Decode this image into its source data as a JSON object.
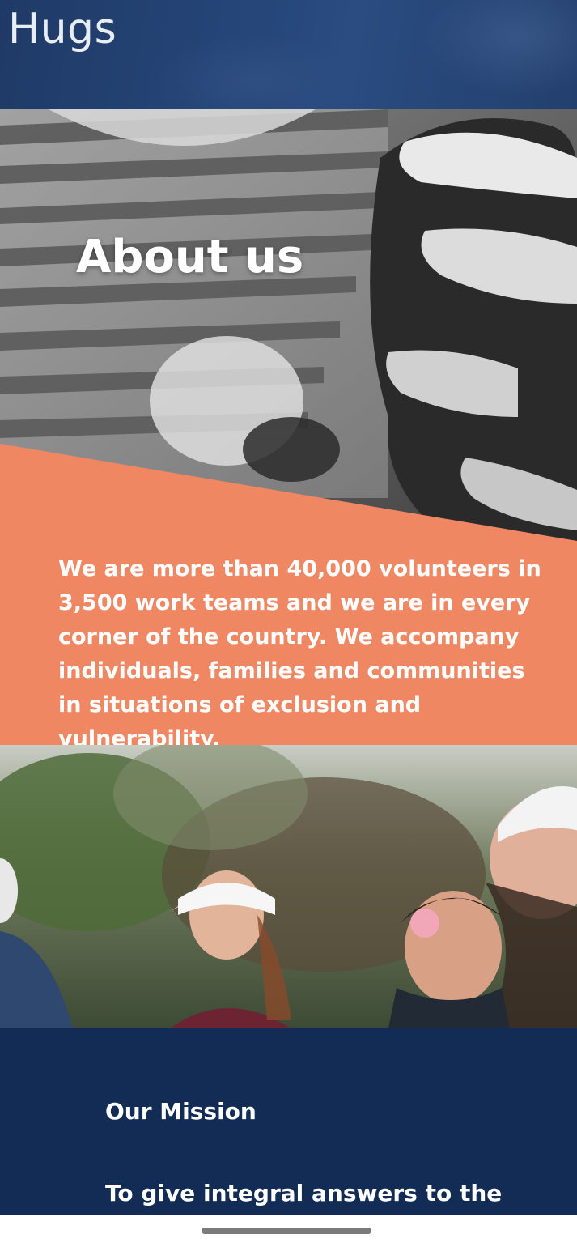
{
  "header": {
    "brand": "Hugs",
    "background_color": "#213e6f"
  },
  "hero": {
    "title": "About us",
    "image": "black-and-white photo of child in striped shirt holding an adult hand"
  },
  "intro": {
    "text": "We are more than 40,000 volunteers in 3,500 work teams and we are in every corner of the country. We accompany individuals, families and communities in situations of exclusion and vulnerability.",
    "background_color": "#f08763"
  },
  "photo": {
    "image": "volunteers in white caps hugging outdoors"
  },
  "mission": {
    "title": "Our Mission",
    "text": "To give integral answers to the",
    "background_color": "#132c55"
  },
  "system": {
    "home_indicator": "home-indicator"
  }
}
